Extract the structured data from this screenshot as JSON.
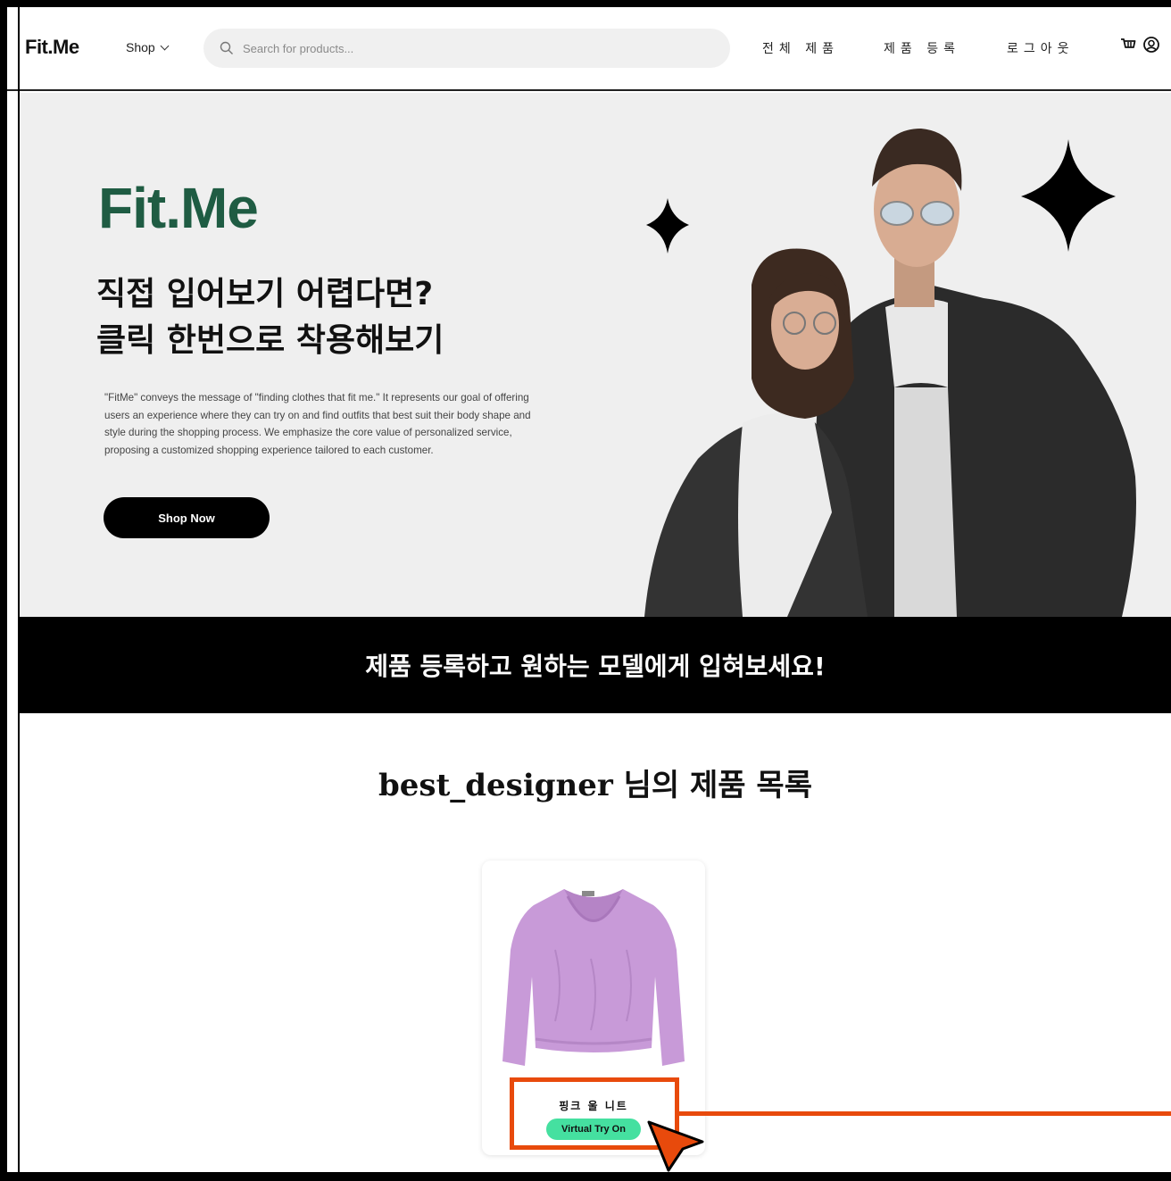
{
  "header": {
    "logo": "Fit.Me",
    "shop_label": "Shop",
    "search_placeholder": "Search for products...",
    "nav": [
      "전체 제품",
      "제품 등록",
      "로그아웃"
    ],
    "icons": [
      "cart-icon",
      "user-icon"
    ]
  },
  "hero": {
    "logo": "Fit.Me",
    "headline_1": "직접 입어보기 어렵다면?",
    "headline_2": "클릭 한번으로 착용해보기",
    "description": "\"FitMe\" conveys the message of \"finding clothes that fit me.\" It represents our goal of offering users an experience where they can try on and find outfits that best suit their body shape and style during the shopping process. We emphasize the core value of personalized service, proposing a customized shopping experience tailored to each customer.",
    "cta": "Shop Now"
  },
  "banner": {
    "text": "제품 등록하고 원하는 모델에게 입혀보세요!"
  },
  "products_section": {
    "designer": "best_designer",
    "title_rest": " 님의 제품 목록",
    "items": [
      {
        "name": "핑크 울 니트",
        "action": "Virtual Try On"
      }
    ]
  },
  "colors": {
    "brand_green": "#1f5c43",
    "try_on_green": "#45e0a0",
    "annotation": "#e84a0c",
    "hero_bg": "#efefef"
  }
}
